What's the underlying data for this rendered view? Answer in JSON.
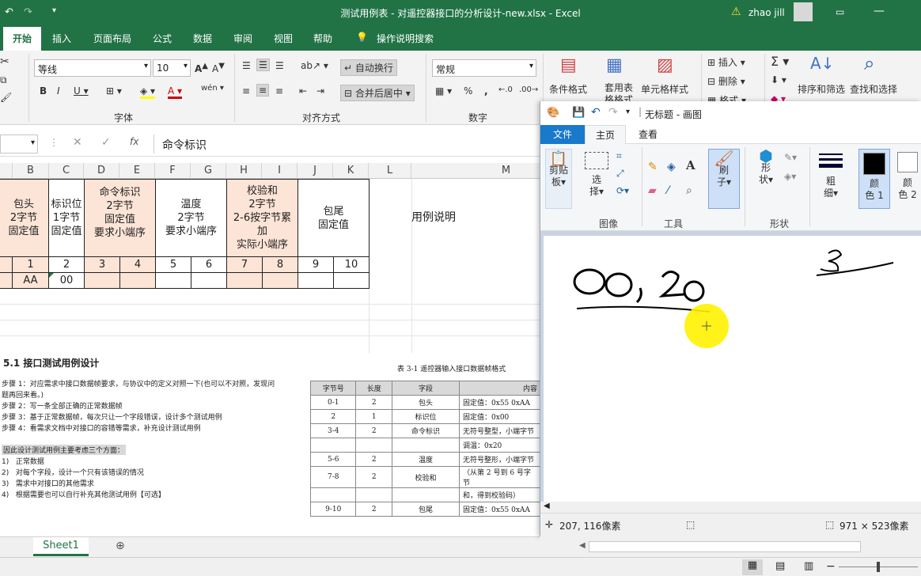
{
  "excel": {
    "title": "测试用例表 - 对遥控器接口的分析设计-new.xlsx  -  Excel",
    "user": "zhao jill",
    "warning_icon": "warning-icon",
    "tabs": [
      "开始",
      "插入",
      "页面布局",
      "公式",
      "数据",
      "审阅",
      "视图",
      "帮助",
      "操作说明搜索"
    ],
    "ribbon": {
      "font_name": "等线",
      "font_size": "10",
      "wrap_text": "自动换行",
      "merge_center": "合并后居中",
      "number_format": "常规",
      "groups": [
        "字体",
        "对齐方式",
        "数字"
      ],
      "styles": [
        "条件格式",
        "套用表格格式",
        "单元格样式"
      ],
      "cells": [
        "插入",
        "删除",
        "格式"
      ],
      "editing": [
        "排序和筛选",
        "查找和选择"
      ]
    },
    "formula_bar": {
      "fx": "fx",
      "value": "命令标识"
    },
    "columns": [
      "B",
      "C",
      "D",
      "E",
      "F",
      "G",
      "H",
      "I",
      "J",
      "K",
      "L",
      "M"
    ],
    "headers": {
      "baotou": [
        "包头",
        "2字节",
        "固定值"
      ],
      "biaoshi": [
        "标识位",
        "1字节",
        "固定值"
      ],
      "mingling": [
        "命令标识",
        "2字节",
        "固定值",
        "要求小端序"
      ],
      "wendu": [
        "温度",
        "2字节",
        "要求小端序"
      ],
      "jiaoyan": [
        "校验和",
        "2字节",
        "2-6按字节累",
        "加",
        "实际小端序"
      ],
      "baowei": [
        "包尾",
        "固定值"
      ],
      "shuoming": "用例说明"
    },
    "index_row": [
      "1",
      "2",
      "3",
      "4",
      "5",
      "6",
      "7",
      "8",
      "9",
      "10"
    ],
    "value_row": [
      "AA",
      "00"
    ],
    "doc": {
      "heading": "5.1  接口测试用例设计",
      "steps": [
        "步骤 1：对应需求中接口数据帧要求，与协议中的定义对照一下(也可以不对照，发现问",
        "题再回来看。)",
        "步骤 2：写一条全部正确的正常数据帧",
        "步骤 3：基于正常数据帧，每次只让一个字段错误，设计多个测试用例",
        "步骤 4：看需求文档中对接口的容错等需求，补充设计测试用例"
      ],
      "consider_title": "因此设计测试用例主要考虑三个方面：",
      "considers": [
        {
          "n": "1)",
          "t": "正常数据"
        },
        {
          "n": "2)",
          "t": "对每个字段，设计一个只有该错误的情况"
        },
        {
          "n": "3)",
          "t": "需求中对接口的其他需求"
        },
        {
          "n": "4)",
          "t": "根据需要也可以自行补充其他测试用例【可选】"
        }
      ],
      "table_caption": "表 3-1  遥控器输入接口数据帧格式",
      "table_head": [
        "字节号",
        "长度",
        "字段",
        "内容"
      ],
      "table_rows": [
        [
          "0-1",
          "2",
          "包头",
          "固定值：0x55  0xAA"
        ],
        [
          "2",
          "1",
          "标识位",
          "固定值：0x00"
        ],
        [
          "3-4",
          "2",
          "命令标识",
          "无符号整型，小端字节"
        ],
        [
          "",
          "",
          "",
          "调温：0x20"
        ],
        [
          "5-6",
          "2",
          "温度",
          "无符号整形，小端字节"
        ],
        [
          "7-8",
          "2",
          "校验和",
          "（从第 2 号到 6 号字节"
        ],
        [
          "",
          "",
          "",
          "和，得到校验码）"
        ],
        [
          "9-10",
          "2",
          "包尾",
          "固定值：0x55  0xAA"
        ]
      ]
    },
    "sheet_tab": "Sheet1"
  },
  "paint": {
    "title": "无标题 - 画图",
    "tabs": [
      "文件",
      "主页",
      "查看"
    ],
    "groups": [
      "图像",
      "工具",
      "形状"
    ],
    "buttons": {
      "paste": [
        "剪贴",
        "板▾"
      ],
      "select": [
        "选",
        "择▾"
      ],
      "brush": [
        "刷",
        "子▾"
      ],
      "shapes": [
        "形",
        "状▾"
      ],
      "size": [
        "粗",
        "细▾"
      ],
      "color1": [
        "颜",
        "色 1"
      ],
      "color2": [
        "颜",
        "色 2"
      ]
    },
    "colors": {
      "color1": "#000000",
      "color2": "#ffffff"
    },
    "status": {
      "cursor": "207, 116像素",
      "size": "971 × 523像素"
    }
  }
}
